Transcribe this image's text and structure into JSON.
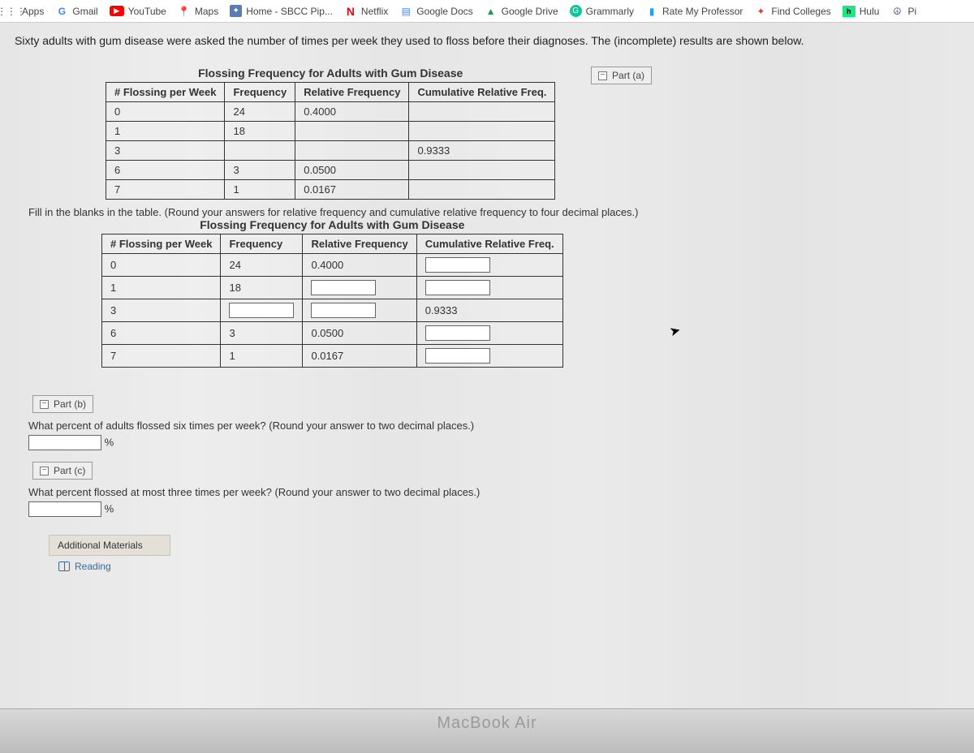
{
  "bookmarks": {
    "apps": "Apps",
    "gmail": "Gmail",
    "youtube": "YouTube",
    "maps": "Maps",
    "home": "Home - SBCC Pip...",
    "netflix": "Netflix",
    "gdocs": "Google Docs",
    "gdrive": "Google Drive",
    "grammarly": "Grammarly",
    "rmp": "Rate My Professor",
    "findcolleges": "Find Colleges",
    "hulu": "Hulu",
    "pin": "Pi"
  },
  "problem_intro": "Sixty adults with gum disease were asked the number of times per week they used to floss before their diagnoses. The (incomplete) results are shown below.",
  "table1": {
    "caption": "Flossing Frequency for Adults with Gum Disease",
    "headers": {
      "c1": "# Flossing per Week",
      "c2": "Frequency",
      "c3": "Relative Frequency",
      "c4": "Cumulative Relative Freq."
    },
    "rows": [
      {
        "c1": "0",
        "c2": "24",
        "c3": "0.4000",
        "c4": ""
      },
      {
        "c1": "1",
        "c2": "18",
        "c3": "",
        "c4": ""
      },
      {
        "c1": "3",
        "c2": "",
        "c3": "",
        "c4": "0.9333"
      },
      {
        "c1": "6",
        "c2": "3",
        "c3": "0.0500",
        "c4": ""
      },
      {
        "c1": "7",
        "c2": "1",
        "c3": "0.0167",
        "c4": ""
      }
    ]
  },
  "part_a": {
    "label": "Part (a)",
    "instr": "Fill in the blanks in the table. (Round your answers for relative frequency and cumulative relative frequency to four decimal places.)"
  },
  "table2": {
    "caption": "Flossing Frequency for Adults with Gum Disease",
    "headers": {
      "c1": "# Flossing per Week",
      "c2": "Frequency",
      "c3": "Relative Frequency",
      "c4": "Cumulative Relative Freq."
    },
    "rows": [
      {
        "c1": "0",
        "c2": "24",
        "c3": "0.4000",
        "c4_input": true
      },
      {
        "c1": "1",
        "c2": "18",
        "c3_input": true,
        "c4_input": true
      },
      {
        "c1": "3",
        "c2_input": true,
        "c3_input": true,
        "c4": "0.9333"
      },
      {
        "c1": "6",
        "c2": "3",
        "c3": "0.0500",
        "c4_input": true
      },
      {
        "c1": "7",
        "c2": "1",
        "c3": "0.0167",
        "c4_input": true
      }
    ]
  },
  "part_b": {
    "label": "Part (b)",
    "question": "What percent of adults flossed six times per week? (Round your answer to two decimal places.)",
    "unit": "%"
  },
  "part_c": {
    "label": "Part (c)",
    "question": "What percent flossed at most three times per week? (Round your answer to two decimal places.)",
    "unit": "%"
  },
  "additional": {
    "title": "Additional Materials",
    "reading": "Reading"
  },
  "footer": "MacBook Air",
  "chart_data": {
    "type": "table",
    "title": "Flossing Frequency for Adults with Gum Disease",
    "columns": [
      "# Flossing per Week",
      "Frequency",
      "Relative Frequency",
      "Cumulative Relative Freq."
    ],
    "rows": [
      [
        0,
        24,
        0.4,
        null
      ],
      [
        1,
        18,
        null,
        null
      ],
      [
        3,
        null,
        null,
        0.9333
      ],
      [
        6,
        3,
        0.05,
        null
      ],
      [
        7,
        1,
        0.0167,
        null
      ]
    ],
    "n": 60
  }
}
